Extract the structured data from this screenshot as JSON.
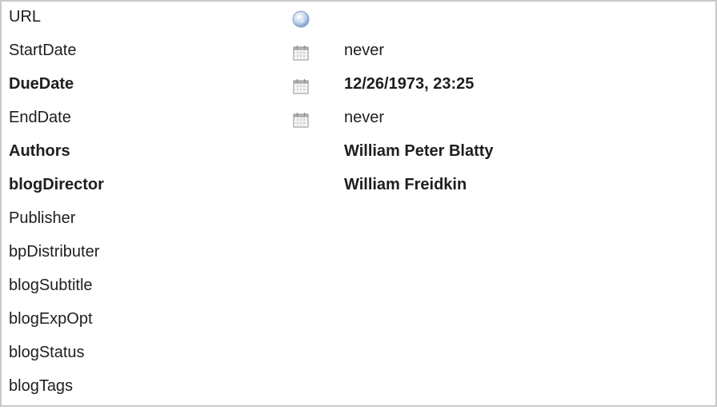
{
  "fields": [
    {
      "label": "URL",
      "icon": "globe-icon",
      "value": ""
    },
    {
      "label": "StartDate",
      "icon": "calendar-icon",
      "value": "never"
    },
    {
      "label": "DueDate",
      "icon": "calendar-icon",
      "value": "12/26/1973, 23:25"
    },
    {
      "label": "EndDate",
      "icon": "calendar-icon",
      "value": "never"
    },
    {
      "label": "Authors",
      "value": "William Peter Blatty"
    },
    {
      "label": "blogDirector",
      "value": "William Freidkin"
    },
    {
      "label": "Publisher",
      "value": ""
    },
    {
      "label": "bpDistributer",
      "value": ""
    },
    {
      "label": "blogSubtitle",
      "value": ""
    },
    {
      "label": "blogExpOpt",
      "value": ""
    },
    {
      "label": "blogStatus",
      "value": ""
    },
    {
      "label": "blogTags",
      "value": ""
    }
  ]
}
